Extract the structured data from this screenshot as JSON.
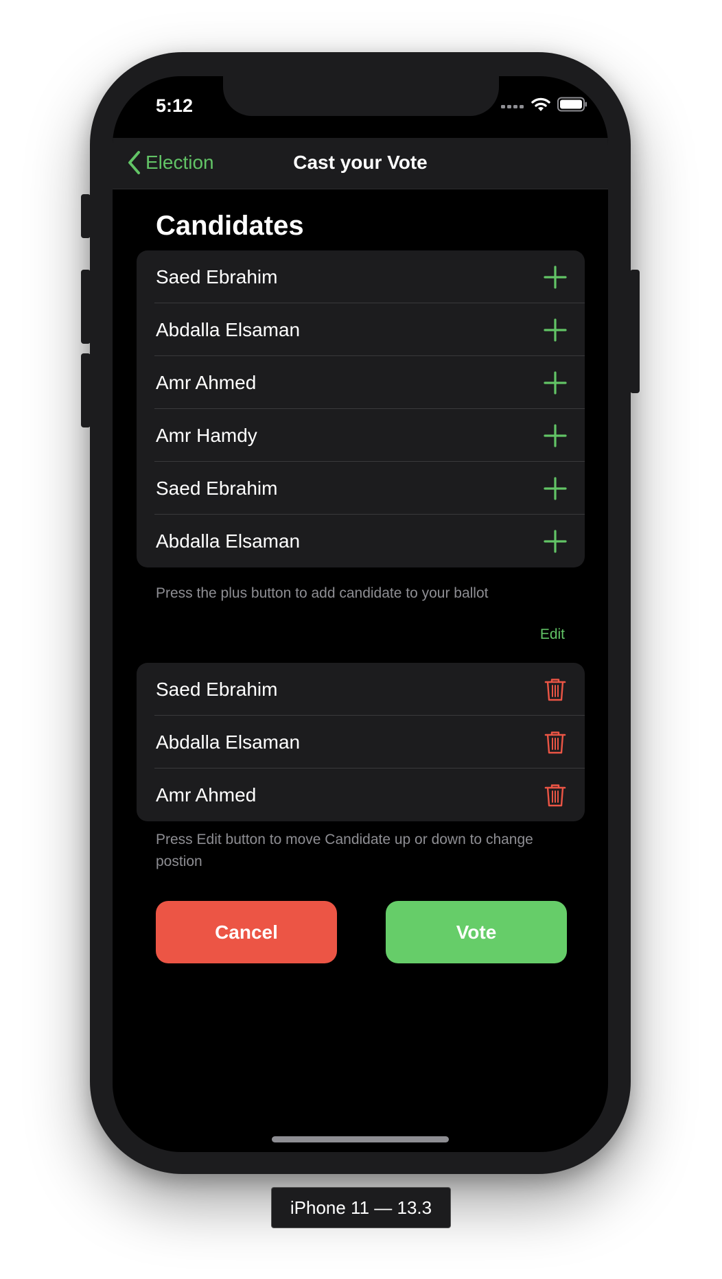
{
  "status_bar": {
    "time": "5:12"
  },
  "nav": {
    "back_label": "Election",
    "title": "Cast your Vote"
  },
  "candidates": {
    "title": "Candidates",
    "items": [
      "Saed Ebrahim",
      "Abdalla Elsaman",
      "Amr Ahmed",
      "Amr Hamdy",
      "Saed Ebrahim",
      "Abdalla Elsaman"
    ],
    "footer": "Press the plus button to add candidate to your ballot"
  },
  "ballot": {
    "edit_label": "Edit",
    "items": [
      "Saed Ebrahim",
      "Abdalla Elsaman",
      "Amr Ahmed"
    ],
    "footer": "Press Edit button to move Candidate up or down to change postion"
  },
  "buttons": {
    "cancel": "Cancel",
    "vote": "Vote"
  },
  "device_label": "iPhone 11 — 13.3",
  "colors": {
    "accent_green": "#62c466",
    "destructive_red": "#eb5545",
    "cancel_button": "#ec5545",
    "vote_button": "#66cd69"
  },
  "icons": {
    "add": "plus-icon",
    "delete": "trash-icon",
    "back": "chevron-left-icon"
  }
}
